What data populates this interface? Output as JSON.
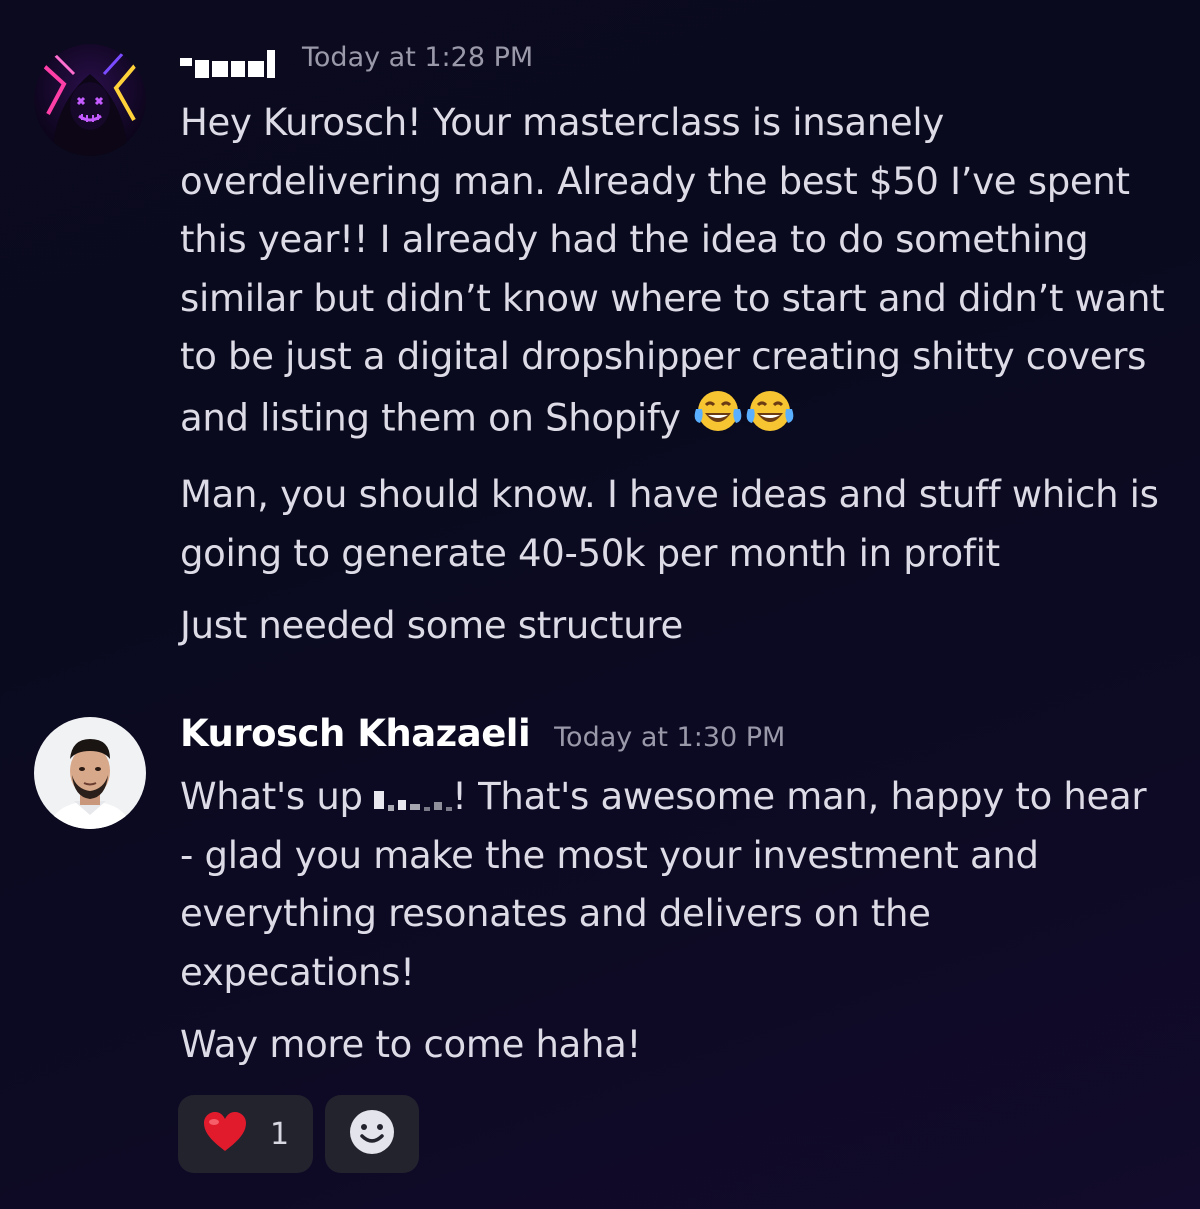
{
  "messages": [
    {
      "author": "",
      "timestamp": "Today at 1:28 PM",
      "paragraphs": [
        "Hey Kurosch! Your masterclass is insanely overdelivering man. Already the best $50 I’ve spent this year!! I already had the idea to do something similar but didn’t know where to start and didn’t want to be just a digital dropshipper creating shitty covers and listing them on Shopify",
        "Man, you should know. I have ideas and stuff which is going to generate 40-50k per month in profit",
        "Just needed some structure"
      ],
      "emoji": [
        "face-with-tears-of-joy",
        "face-with-tears-of-joy"
      ]
    },
    {
      "author": "Kurosch Khazaeli",
      "timestamp": "Today at 1:30 PM",
      "greeting": "What's up",
      "greeting_rest": "! That's awesome man, happy to hear - glad you make the most your investment and everything resonates and delivers on the expecations!",
      "paragraphs": [
        "Way more to come haha!"
      ]
    }
  ],
  "reactions": [
    {
      "emoji": "red-heart",
      "count": "1"
    }
  ],
  "add_reaction_icon": "smiley-add-reaction-icon",
  "colors": {
    "background": "#0b0a1e",
    "text": "#dcdbe6",
    "username": "#ffffff",
    "timestamp": "#9a99aa",
    "reaction_bg": "#23232e"
  }
}
